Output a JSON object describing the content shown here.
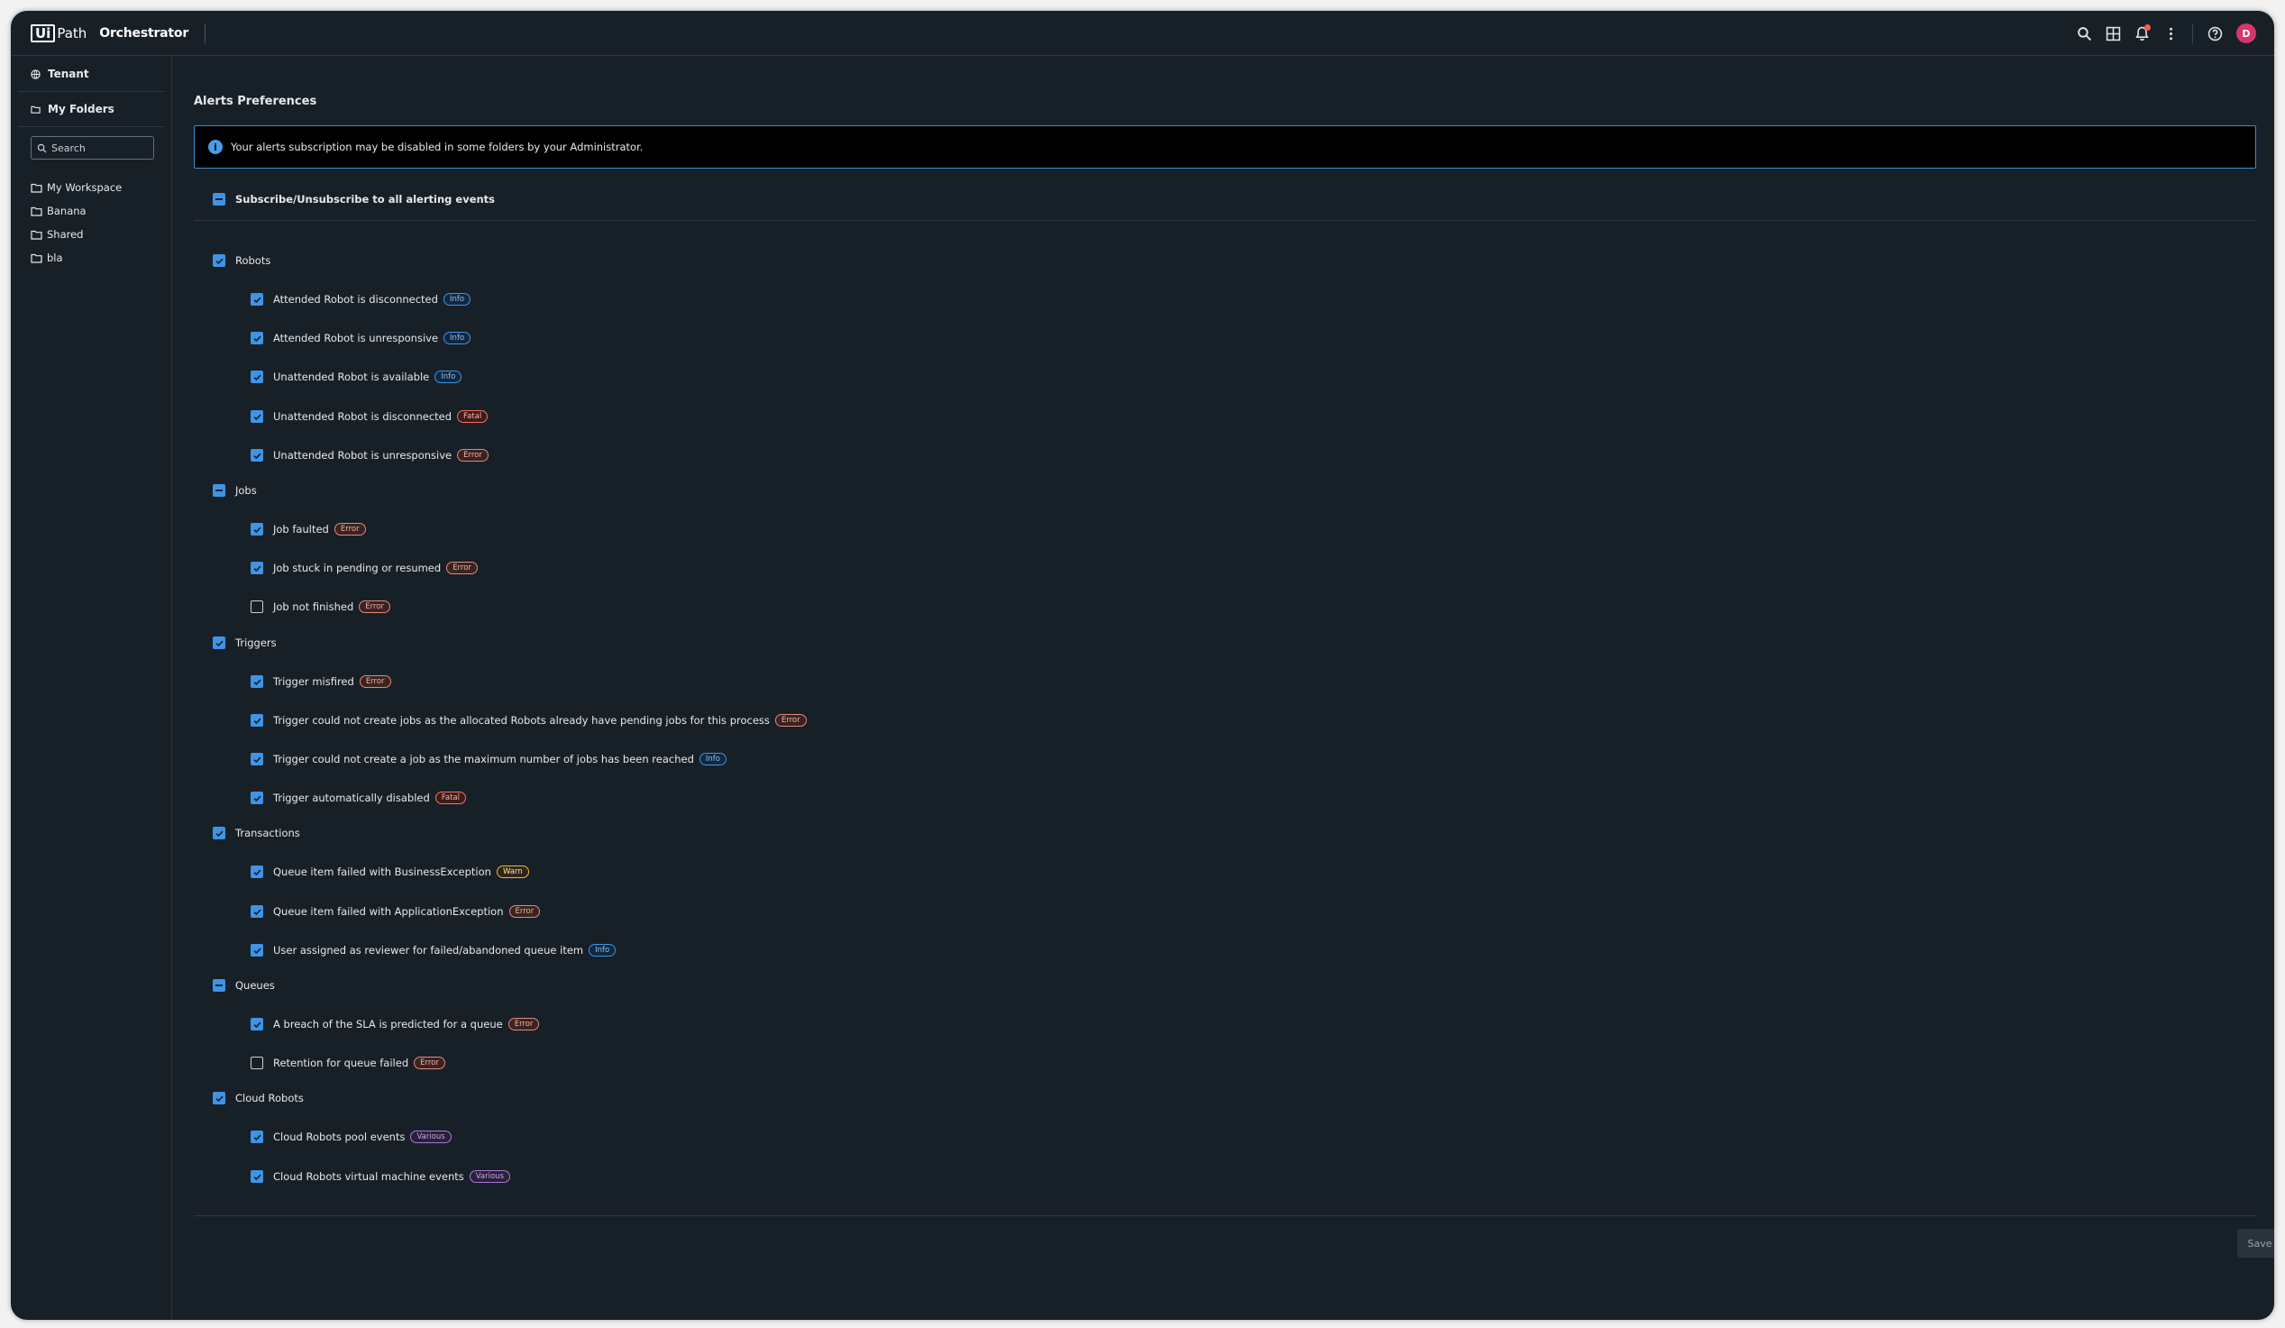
{
  "app": {
    "logo_ui": "Ui",
    "logo_path": "Path",
    "product": "Orchestrator",
    "avatar_initial": "D"
  },
  "icons": [
    "search-icon",
    "apps-grid-icon",
    "bell-icon",
    "more-vertical-icon",
    "help-icon"
  ],
  "sidebar": {
    "tenant_label": "Tenant",
    "my_folders_label": "My Folders",
    "search_placeholder": "Search",
    "folders": [
      "My Workspace",
      "Banana",
      "Shared",
      "bla"
    ]
  },
  "main": {
    "title": "Alerts Preferences",
    "banner_text": "Your alerts subscription may be disabled in some folders by your Administrator.",
    "master_label": "Subscribe/Unsubscribe to all alerting events",
    "save_label": "Save",
    "groups": [
      {
        "label": "Robots",
        "state": "checked",
        "items": [
          {
            "label": "Attended Robot is disconnected",
            "badge": "Info",
            "checked": true
          },
          {
            "label": "Attended Robot is unresponsive",
            "badge": "Info",
            "checked": true
          },
          {
            "label": "Unattended Robot is available",
            "badge": "Info",
            "checked": true
          },
          {
            "label": "Unattended Robot is disconnected",
            "badge": "Fatal",
            "checked": true
          },
          {
            "label": "Unattended Robot is unresponsive",
            "badge": "Error",
            "checked": true
          }
        ]
      },
      {
        "label": "Jobs",
        "state": "indeterminate",
        "items": [
          {
            "label": "Job faulted",
            "badge": "Error",
            "checked": true
          },
          {
            "label": "Job stuck in pending or resumed",
            "badge": "Error",
            "checked": true
          },
          {
            "label": "Job not finished",
            "badge": "Error",
            "checked": false
          }
        ]
      },
      {
        "label": "Triggers",
        "state": "checked",
        "items": [
          {
            "label": "Trigger misfired",
            "badge": "Error",
            "checked": true
          },
          {
            "label": "Trigger could not create jobs as the allocated Robots already have pending jobs for this process",
            "badge": "Error",
            "checked": true
          },
          {
            "label": "Trigger could not create a job as the maximum number of jobs has been reached",
            "badge": "Info",
            "checked": true
          },
          {
            "label": "Trigger automatically disabled",
            "badge": "Fatal",
            "checked": true
          }
        ]
      },
      {
        "label": "Transactions",
        "state": "checked",
        "items": [
          {
            "label": "Queue item failed with BusinessException",
            "badge": "Warn",
            "checked": true
          },
          {
            "label": "Queue item failed with ApplicationException",
            "badge": "Error",
            "checked": true
          },
          {
            "label": "User assigned as reviewer for failed/abandoned queue item",
            "badge": "Info",
            "checked": true
          }
        ]
      },
      {
        "label": "Queues",
        "state": "indeterminate",
        "items": [
          {
            "label": "A breach of the SLA is predicted for a queue",
            "badge": "Error",
            "checked": true
          },
          {
            "label": "Retention for queue failed",
            "badge": "Error",
            "checked": false
          }
        ]
      },
      {
        "label": "Cloud Robots",
        "state": "checked",
        "items": [
          {
            "label": "Cloud Robots pool events",
            "badge": "Various",
            "checked": true
          },
          {
            "label": "Cloud Robots virtual machine events",
            "badge": "Various",
            "checked": true
          }
        ]
      }
    ]
  }
}
